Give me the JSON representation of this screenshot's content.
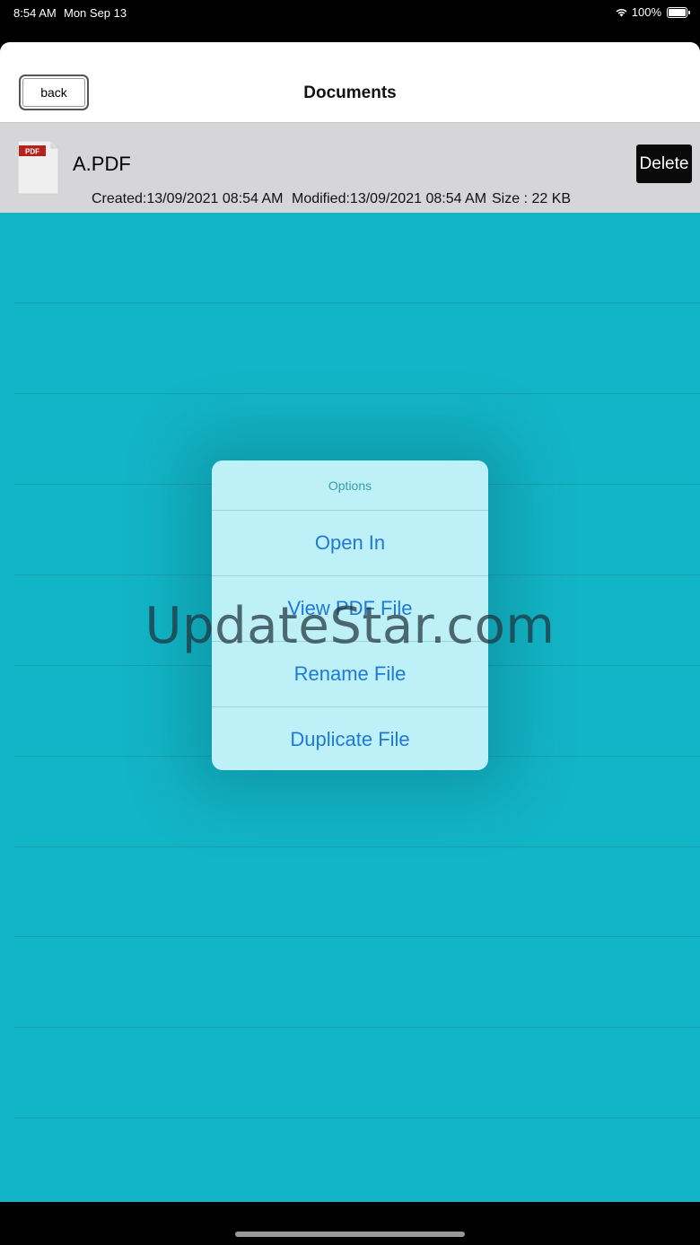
{
  "status_bar": {
    "time": "8:54 AM",
    "date": "Mon Sep 13",
    "battery_percent": "100%",
    "wifi_icon": "wifi-icon",
    "battery_icon": "battery-icon"
  },
  "nav": {
    "back_label": "back",
    "title": "Documents"
  },
  "file": {
    "icon": "pdf-file-icon",
    "icon_badge": "PDF",
    "name": "A.PDF",
    "created": "Created:13/09/2021 08:54 AM",
    "modified": "Modified:13/09/2021 08:54 AM",
    "size": "Size : 22 KB",
    "delete_label": "Delete"
  },
  "options_menu": {
    "title": "Options",
    "items": [
      {
        "label": "Open In"
      },
      {
        "label": "View PDF File"
      },
      {
        "label": "Rename File"
      },
      {
        "label": "Duplicate File"
      }
    ]
  },
  "watermark": "UpdateStar.com",
  "colors": {
    "background_teal": "#12b5c7",
    "popover_bg": "#bdf0f7",
    "menu_text_blue": "#1f79d6"
  }
}
